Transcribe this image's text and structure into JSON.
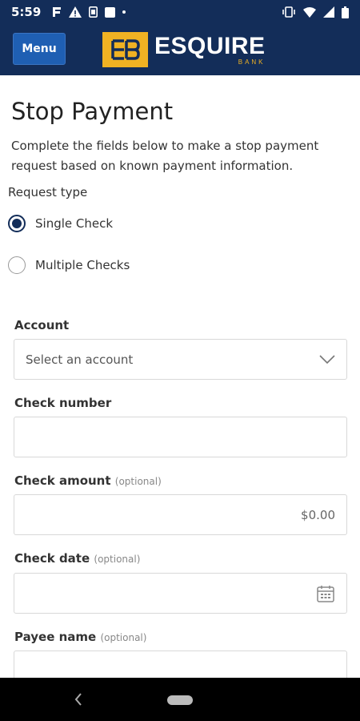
{
  "status_bar": {
    "time": "5:59",
    "icons_left": [
      "f-icon",
      "warning-icon",
      "sim-icon",
      "app-icon",
      "dot-icon"
    ],
    "icons_right": [
      "vibrate-icon",
      "wifi-icon",
      "signal-icon",
      "battery-icon"
    ]
  },
  "header": {
    "menu_label": "Menu",
    "logo_name": "ESQUIRE",
    "logo_sub": "BANK",
    "accent_color": "#f0b223",
    "brand_color": "#132d59"
  },
  "page": {
    "title": "Stop Payment",
    "description": "Complete the fields below to make a stop payment request based on known payment information.",
    "request_type_label": "Request type",
    "request_options": [
      {
        "label": "Single Check",
        "selected": true
      },
      {
        "label": "Multiple Checks",
        "selected": false
      }
    ]
  },
  "form": {
    "account": {
      "label": "Account",
      "placeholder": "Select an account"
    },
    "check_number": {
      "label": "Check number",
      "value": ""
    },
    "check_amount": {
      "label": "Check amount",
      "optional": "(optional)",
      "value": "$0.00"
    },
    "check_date": {
      "label": "Check date",
      "optional": "(optional)",
      "value": ""
    },
    "payee_name": {
      "label": "Payee name",
      "optional": "(optional)",
      "value": ""
    }
  },
  "nav_bar": {
    "back_icon": "back-icon",
    "home_icon": "home-pill"
  }
}
